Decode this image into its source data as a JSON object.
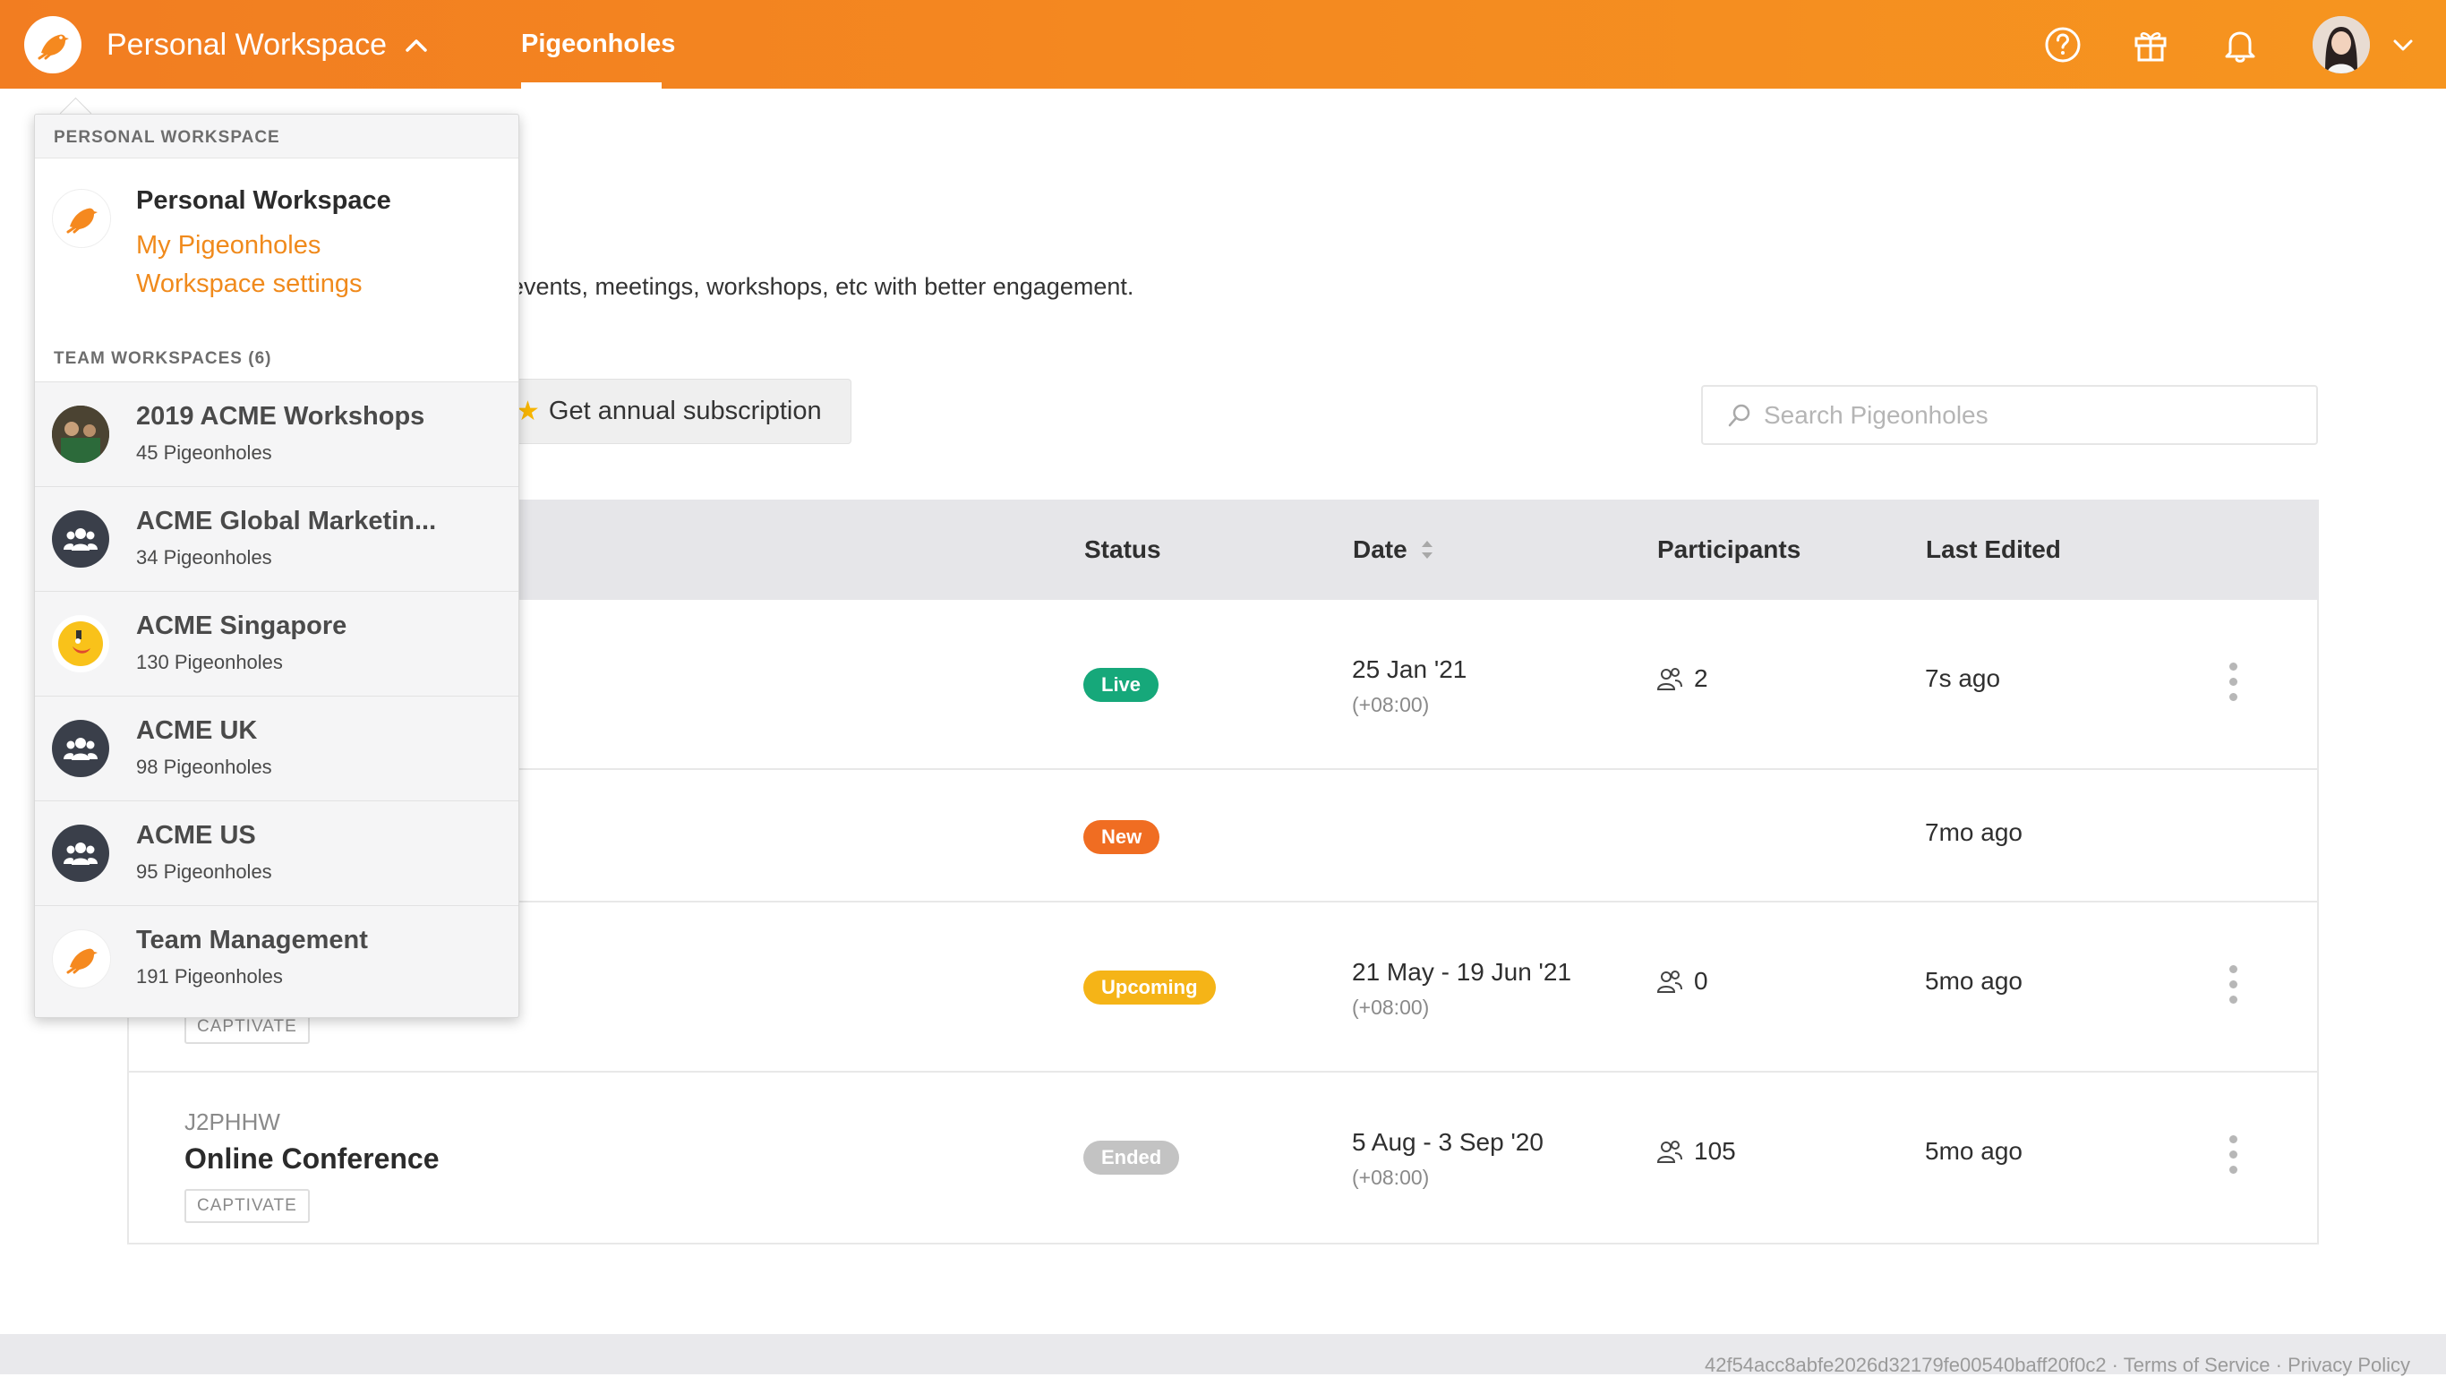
{
  "header": {
    "workspace_name": "Personal Workspace",
    "nav_tab": "Pigeonholes",
    "icons": [
      "help-icon",
      "gift-icon",
      "bell-icon"
    ],
    "accent": "#f5891f"
  },
  "page": {
    "description": "events, meetings, workshops, etc with better engagement.",
    "annual_button": "Get annual subscription",
    "search_placeholder": "Search Pigeonholes"
  },
  "table": {
    "headers": {
      "status": "Status",
      "date": "Date",
      "participants": "Participants",
      "last_edited": "Last Edited"
    },
    "rows": [
      {
        "status": "Live",
        "status_color": "#16a87a",
        "date": "25 Jan '21",
        "tz": "(+08:00)",
        "participants": "2",
        "last_edited": "7s ago"
      },
      {
        "status": "New",
        "status_color": "#f06d22",
        "last_edited": "7mo ago"
      },
      {
        "status": "Upcoming",
        "status_color": "#f5b417",
        "date": "21 May - 19 Jun '21",
        "tz": "(+08:00)",
        "participants": "0",
        "last_edited": "5mo ago",
        "tag": "CAPTIVATE"
      },
      {
        "code": "J2PHHW",
        "title": "Online Conference",
        "tag": "CAPTIVATE",
        "status": "Ended",
        "status_color": "#c3c3c3",
        "date": "5 Aug - 3 Sep '20",
        "tz": "(+08:00)",
        "participants": "105",
        "last_edited": "5mo ago"
      }
    ]
  },
  "footer": {
    "text": "42f54acc8abfe2026d32179fe00540baff20f0c2  ·  Terms of Service  ·  Privacy Policy"
  },
  "dropdown": {
    "personal_label": "PERSONAL WORKSPACE",
    "personal": {
      "name": "Personal Workspace",
      "links": [
        "My Pigeonholes",
        "Workspace settings"
      ]
    },
    "team_label": "TEAM WORKSPACES (6)",
    "teams": [
      {
        "name": "2019 ACME Workshops",
        "count": "45 Pigeonholes",
        "avatar": "photo"
      },
      {
        "name": "ACME Global Marketin...",
        "count": "34 Pigeonholes",
        "avatar": "group-icon"
      },
      {
        "name": "ACME Singapore",
        "count": "130 Pigeonholes",
        "avatar": "emoji-icon"
      },
      {
        "name": "ACME UK",
        "count": "98 Pigeonholes",
        "avatar": "group-icon"
      },
      {
        "name": "ACME US",
        "count": "95 Pigeonholes",
        "avatar": "group-icon"
      },
      {
        "name": "Team Management",
        "count": "191 Pigeonholes",
        "avatar": "pigeon-logo-icon"
      }
    ]
  }
}
